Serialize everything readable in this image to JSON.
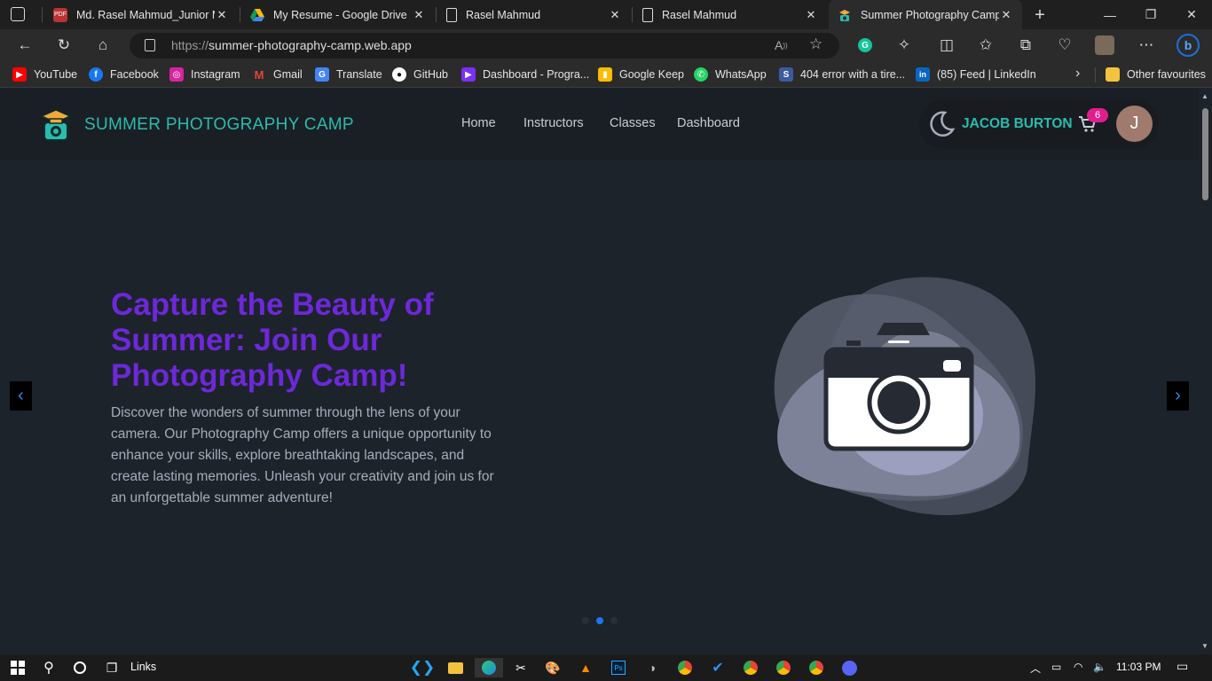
{
  "browser": {
    "tabs": [
      {
        "title": "Md. Rasel Mahmud_Junior MERN",
        "favicon": "pdf-icon"
      },
      {
        "title": "My Resume - Google Drive",
        "favicon": "drive-icon"
      },
      {
        "title": "Rasel Mahmud",
        "favicon": "page-icon"
      },
      {
        "title": "Rasel Mahmud",
        "favicon": "page-icon"
      },
      {
        "title": "Summer Photography Camp",
        "favicon": "camp-icon"
      }
    ],
    "url_scheme": "https://",
    "url_host": "summer-photography-camp.web.app",
    "bookmarks": [
      {
        "label": "YouTube",
        "color": "#ff0000",
        "glyph": "▶"
      },
      {
        "label": "Facebook",
        "color": "#1877f2",
        "glyph": "f"
      },
      {
        "label": "Instagram",
        "color": "#d6249f",
        "glyph": "◎"
      },
      {
        "label": "Gmail",
        "color": "#ea4335",
        "glyph": "M"
      },
      {
        "label": "Translate",
        "color": "#4285f4",
        "glyph": "G"
      },
      {
        "label": "GitHub",
        "color": "#ffffff",
        "glyph": "●"
      },
      {
        "label": "Dashboard - Progra...",
        "color": "#7b2ff7",
        "glyph": "▶"
      },
      {
        "label": "Google Keep",
        "color": "#fbbc04",
        "glyph": "▮"
      },
      {
        "label": "WhatsApp",
        "color": "#25d366",
        "glyph": "✆"
      },
      {
        "label": "404 error with a tire...",
        "color": "#3a5ba0",
        "glyph": "S"
      },
      {
        "label": "(85) Feed | LinkedIn",
        "color": "#0a66c2",
        "glyph": "in"
      }
    ],
    "other_favourites": "Other favourites"
  },
  "site": {
    "brand": "SUMMER PHOTOGRAPHY CAMP",
    "nav": [
      "Home",
      "Instructors",
      "Classes",
      "Dashboard"
    ],
    "user_name": "JACOB BURTON",
    "cart_count": "6",
    "avatar_initial": "J"
  },
  "hero": {
    "title": "Capture the Beauty of Summer: Join Our Photography Camp!",
    "text": "Discover the wonders of summer through the lens of your camera. Our Photography Camp offers a unique opportunity to enhance your skills, explore breathtaking landscapes, and create lasting memories. Unleash your creativity and join us for an unforgettable summer adventure!",
    "prev": "‹",
    "next": "›",
    "slide_count": 3,
    "active_slide": 2
  },
  "taskbar": {
    "links_label": "Links",
    "time": "11:03 PM"
  }
}
